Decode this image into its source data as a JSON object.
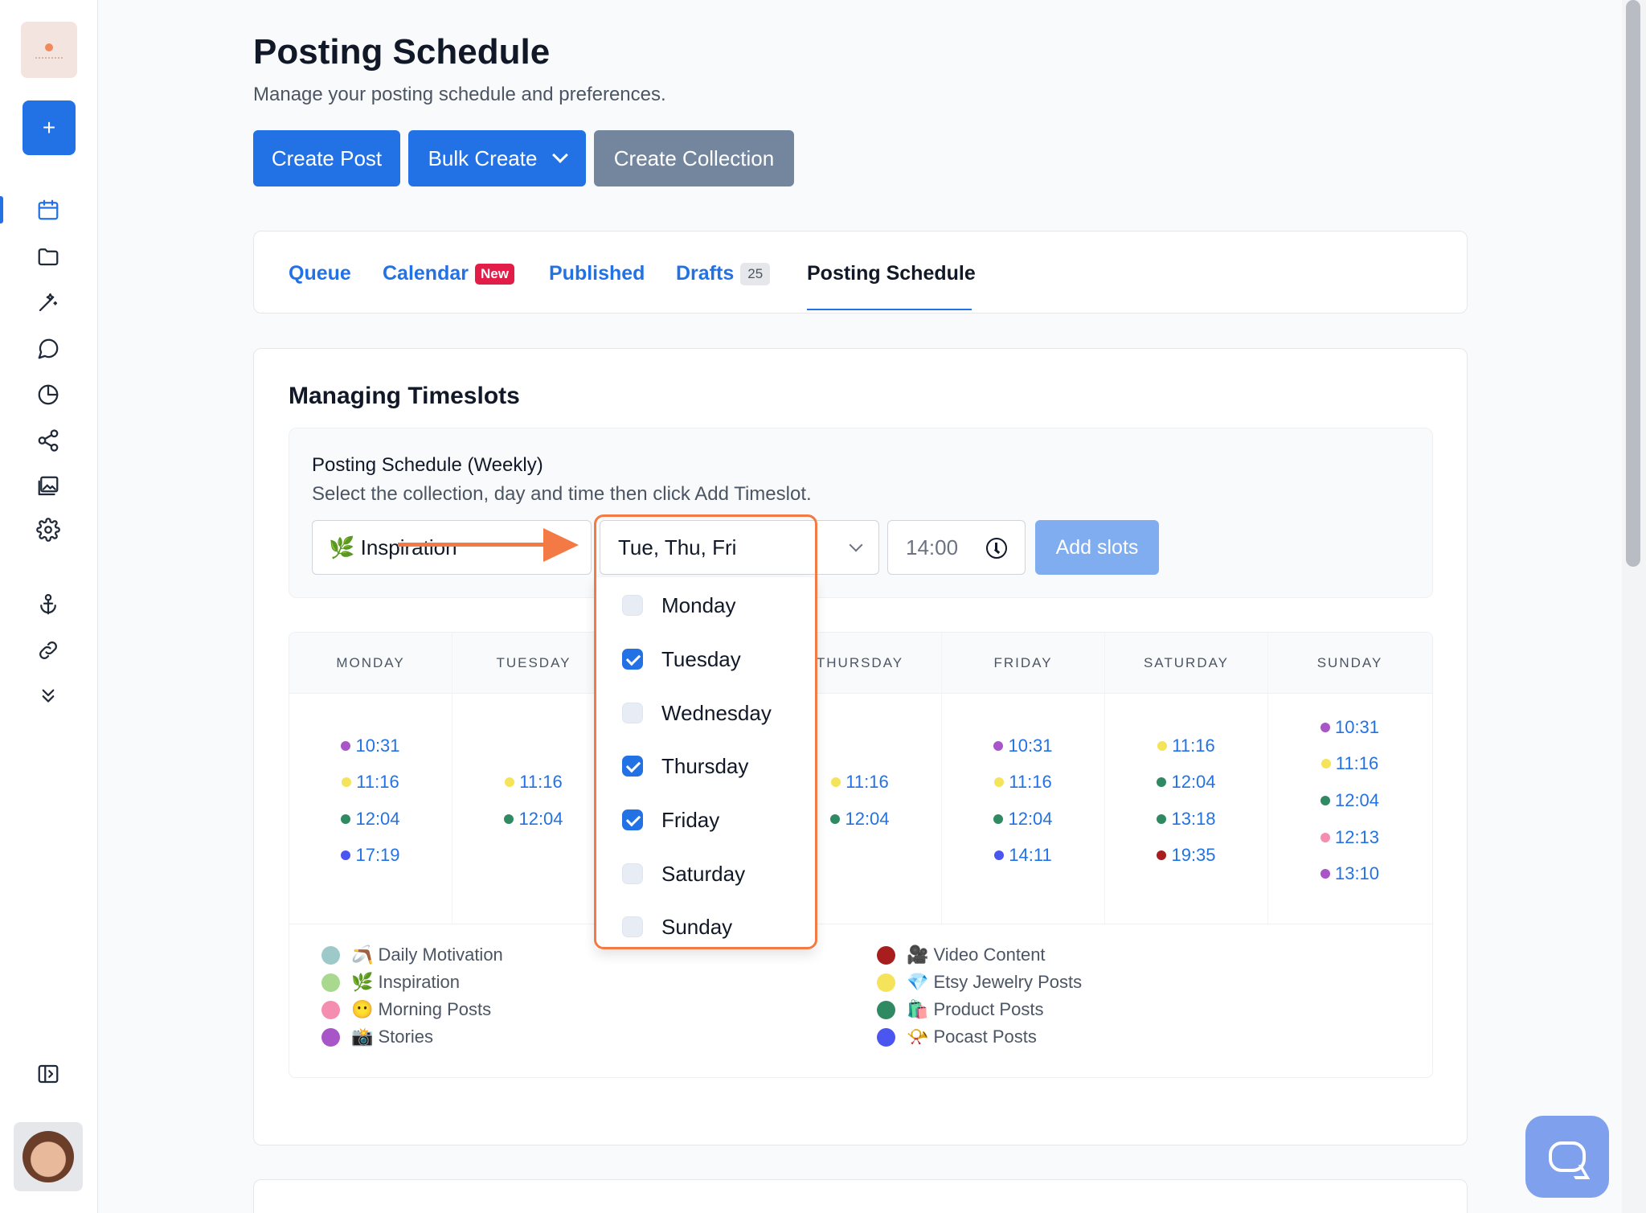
{
  "header": {
    "title": "Posting Schedule",
    "subtitle": "Manage your posting schedule and preferences.",
    "create_post": "Create Post",
    "bulk_create": "Bulk Create",
    "create_collection": "Create Collection"
  },
  "tabs": {
    "queue": "Queue",
    "calendar": "Calendar",
    "calendar_badge": "New",
    "published": "Published",
    "drafts": "Drafts",
    "drafts_count": "25",
    "posting_schedule": "Posting Schedule"
  },
  "timeslots": {
    "title": "Managing Timeslots",
    "form_label": "Posting Schedule (Weekly)",
    "form_help": "Select the collection, day and time then click Add Timeslot.",
    "collection_value": "🌿 Inspiration",
    "days_value": "Tue, Thu, Fri",
    "time_value": "14:00",
    "add_button": "Add slots"
  },
  "days": {
    "monday": "MONDAY",
    "tuesday": "TUESDAY",
    "thursday": "THURSDAY",
    "friday": "FRIDAY",
    "saturday": "SATURDAY",
    "sunday": "SUNDAY"
  },
  "slots": {
    "mon": [
      "10:31",
      "11:16",
      "12:04",
      "17:19"
    ],
    "tue": [
      "11:16",
      "12:04"
    ],
    "thu": [
      "11:16",
      "12:04"
    ],
    "fri": [
      "10:31",
      "11:16",
      "12:04",
      "14:11"
    ],
    "sat": [
      "11:16",
      "12:04",
      "13:18",
      "19:35"
    ],
    "sun": [
      "10:31",
      "11:16",
      "12:04",
      "12:13",
      "13:10"
    ]
  },
  "legend": {
    "daily_motivation": "🪃 Daily Motivation",
    "inspiration": "🌿 Inspiration",
    "morning_posts": "😶 Morning Posts",
    "stories": "📸 Stories",
    "video_content": "🎥 Video Content",
    "etsy": "💎 Etsy Jewelry Posts",
    "product_posts": "🛍️ Product Posts",
    "podcast": "📯 Pocast Posts"
  },
  "dropdown": {
    "monday": "Monday",
    "tuesday": "Tuesday",
    "wednesday": "Wednesday",
    "thursday": "Thursday",
    "friday": "Friday",
    "saturday": "Saturday",
    "sunday": "Sunday",
    "checked": [
      "Tuesday",
      "Thursday",
      "Friday"
    ]
  },
  "colors": {
    "accent": "#2372e5",
    "purple": "#a855c7",
    "yellow": "#f5e35a",
    "green": "#2f8a63",
    "blue": "#4b55f0",
    "darkred": "#a81e1e",
    "pink": "#f58db0",
    "teal": "#9ec9c9",
    "lightgreen": "#a9d98f",
    "highlight": "#f47a45"
  }
}
